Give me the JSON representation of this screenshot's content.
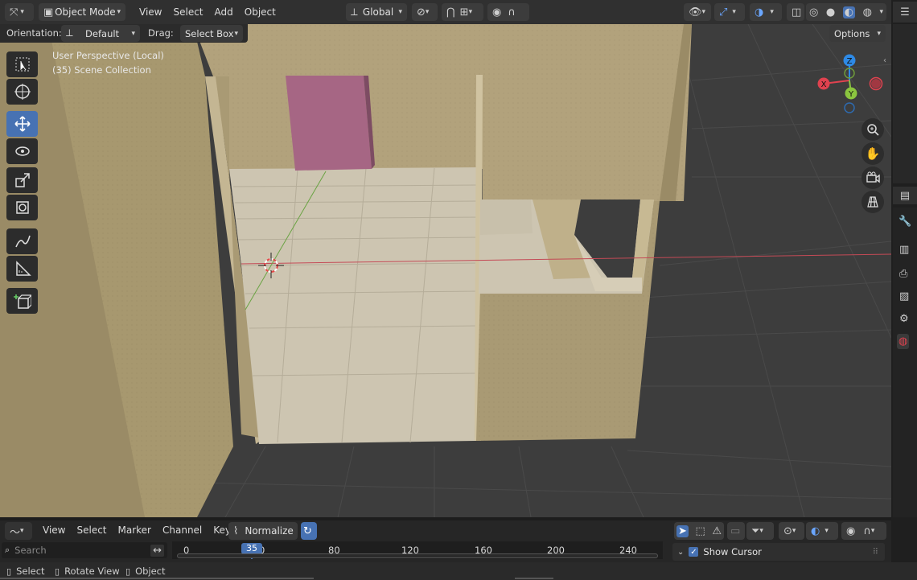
{
  "header": {
    "mode": "Object Mode",
    "menus": [
      "View",
      "Select",
      "Add",
      "Object"
    ],
    "transform_orientation": "Global"
  },
  "toolsettings": {
    "orientation_label": "Orientation:",
    "orientation_value": "Default",
    "drag_label": "Drag:",
    "drag_value": "Select Box",
    "options": "Options"
  },
  "viewport": {
    "view_name": "User Perspective (Local)",
    "collection": "(35) Scene Collection",
    "gizmo": {
      "x": "X",
      "y": "Y",
      "z": "Z"
    }
  },
  "timeline": {
    "menus": [
      "View",
      "Select",
      "Marker",
      "Channel",
      "Key"
    ],
    "normalize": "Normalize",
    "search_placeholder": "Search",
    "current_frame": "35",
    "ticks": [
      "0",
      "80",
      "120",
      "160",
      "200",
      "240"
    ],
    "show_cursor": "Show Cursor"
  },
  "statusbar": {
    "items": [
      "Select",
      "Rotate View",
      "Object"
    ]
  },
  "colors": {
    "accent": "#4772b3",
    "wall": "#b3a27e",
    "floor": "#c9c0ac",
    "magenta": "#a66684",
    "axis_x": "#e0424f",
    "axis_y": "#8bc53f",
    "axis_z": "#2e8ae6"
  }
}
